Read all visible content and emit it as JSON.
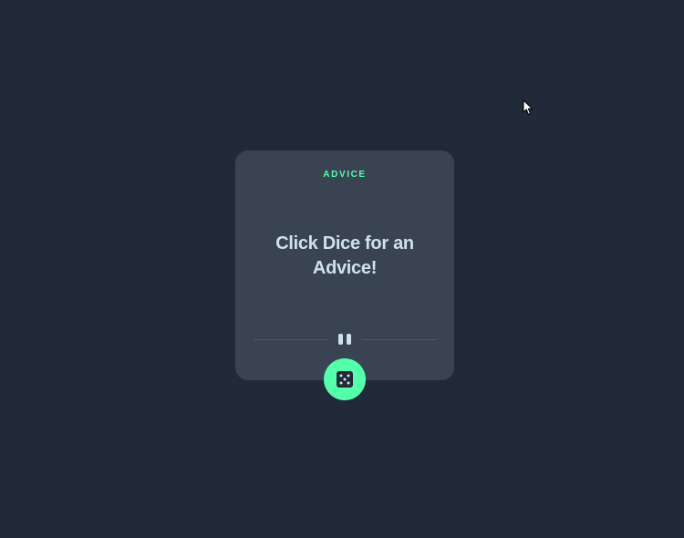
{
  "card": {
    "label": "ADVICE",
    "text": "Click Dice for an Advice!"
  },
  "icons": {
    "divider": "pause-icon",
    "button": "dice-icon",
    "pointer": "mouse-cursor-icon"
  },
  "colors": {
    "background": "#202a38",
    "card": "#3a4352",
    "accent": "#53ffaa",
    "text": "#cee3e9",
    "divider": "#4f5b6b"
  }
}
